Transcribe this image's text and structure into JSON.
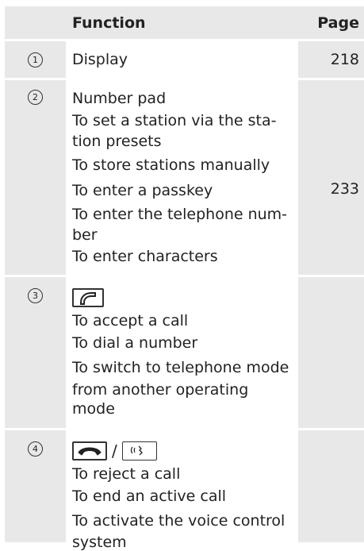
{
  "header": {
    "function": "Function",
    "page": "Page"
  },
  "rows": [
    {
      "num": "1",
      "items": [
        "Display"
      ],
      "page": "218"
    },
    {
      "num": "2",
      "items": [
        "Number pad",
        "To set a station via the sta-",
        "tion presets",
        "To store stations manually",
        "To enter a passkey",
        "To enter the telephone num-",
        "ber",
        "To enter characters"
      ],
      "page": "233"
    },
    {
      "num": "3",
      "icon": "phone-accept-icon",
      "items": [
        "To accept a call",
        "To dial a number",
        "To switch to telephone mode",
        "from another operating",
        "mode"
      ],
      "page": ""
    },
    {
      "num": "4",
      "icon": "phone-end-icon",
      "icon2": "voice-control-icon",
      "items": [
        "To reject a call",
        "To end an active call",
        "To activate the voice control",
        "system"
      ],
      "page": ""
    }
  ]
}
